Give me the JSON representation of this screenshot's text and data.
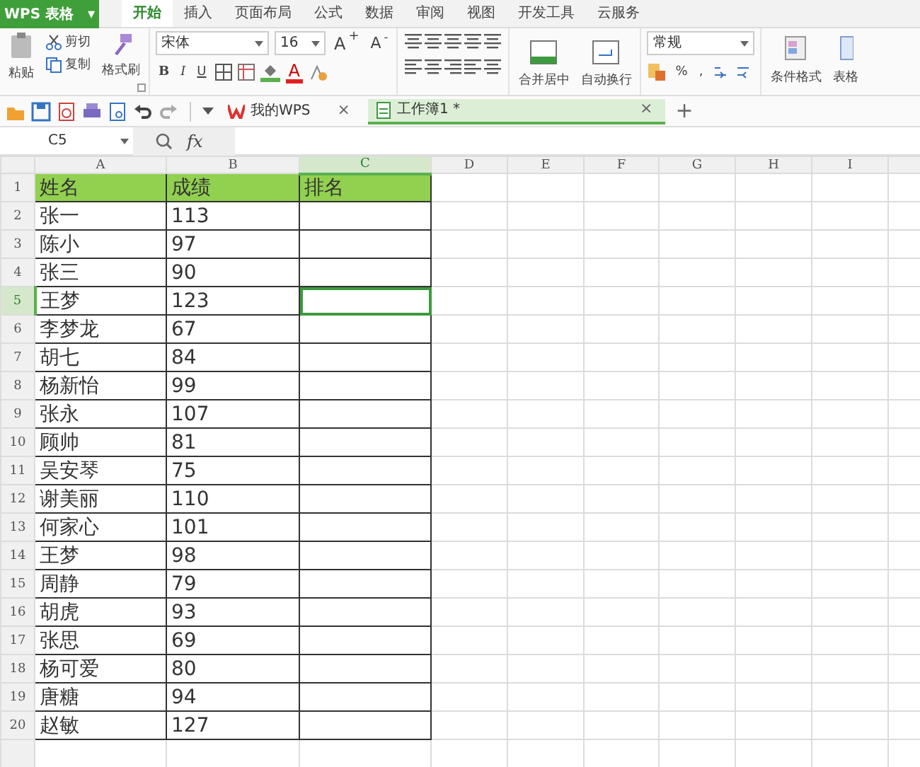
{
  "app": {
    "title": "WPS 表格",
    "menu_caret": "▾"
  },
  "ribbon_tabs": [
    {
      "label": "开始",
      "selected": true
    },
    {
      "label": "插入",
      "selected": false
    },
    {
      "label": "页面布局",
      "selected": false
    },
    {
      "label": "公式",
      "selected": false
    },
    {
      "label": "数据",
      "selected": false
    },
    {
      "label": "审阅",
      "selected": false
    },
    {
      "label": "视图",
      "selected": false
    },
    {
      "label": "开发工具",
      "selected": false
    },
    {
      "label": "云服务",
      "selected": false
    }
  ],
  "clipboard": {
    "paste": "粘贴",
    "cut": "剪切",
    "copy": "复制",
    "format_painter": "格式刷"
  },
  "font": {
    "name": "宋体",
    "size": "16",
    "grow": "A$^{+}$",
    "shrink": "A$^{-}$",
    "bold": "B",
    "italic": "I",
    "underline": "U",
    "font_color": "A"
  },
  "alignment": {
    "merge": "合并居中",
    "wrap": "自动换行"
  },
  "number": {
    "format": "常规",
    "percent": "%",
    "comma": ","
  },
  "styles": {
    "conditional": "条件格式",
    "table": "表格"
  },
  "doc_tabs": [
    {
      "label": "我的WPS",
      "selected": false,
      "close": "×"
    },
    {
      "label": "工作簿1 *",
      "selected": true,
      "close": "×"
    }
  ],
  "new_tab": "+",
  "formula_bar": {
    "name_box": "C5",
    "fx": "fx"
  },
  "sheet": {
    "columns": [
      {
        "label": "A",
        "selected": false
      },
      {
        "label": "B",
        "selected": false
      },
      {
        "label": "C",
        "selected": true
      },
      {
        "label": "D",
        "selected": false
      },
      {
        "label": "E",
        "selected": false
      },
      {
        "label": "F",
        "selected": false
      },
      {
        "label": "G",
        "selected": false
      },
      {
        "label": "H",
        "selected": false
      },
      {
        "label": "I",
        "selected": false
      }
    ],
    "rows": [
      {
        "number": "1",
        "selected": false,
        "kind": "header",
        "cells": [
          "姓名",
          "成绩",
          "排名"
        ]
      },
      {
        "number": "2",
        "selected": false,
        "kind": "data",
        "cells": [
          "张一",
          "113"
        ]
      },
      {
        "number": "3",
        "selected": false,
        "kind": "data",
        "cells": [
          "陈小",
          "97"
        ]
      },
      {
        "number": "4",
        "selected": false,
        "kind": "data",
        "cells": [
          "张三",
          "90"
        ]
      },
      {
        "number": "5",
        "selected": true,
        "kind": "data",
        "cells": [
          "王梦",
          "123"
        ]
      },
      {
        "number": "6",
        "selected": false,
        "kind": "data",
        "cells": [
          "李梦龙",
          "67"
        ]
      },
      {
        "number": "7",
        "selected": false,
        "kind": "data",
        "cells": [
          "胡七",
          "84"
        ]
      },
      {
        "number": "8",
        "selected": false,
        "kind": "data",
        "cells": [
          "杨新怡",
          "99"
        ]
      },
      {
        "number": "9",
        "selected": false,
        "kind": "data",
        "cells": [
          "张永",
          "107"
        ]
      },
      {
        "number": "10",
        "selected": false,
        "kind": "data",
        "cells": [
          "顾帅",
          "81"
        ]
      },
      {
        "number": "11",
        "selected": false,
        "kind": "data",
        "cells": [
          "吴安琴",
          "75"
        ]
      },
      {
        "number": "12",
        "selected": false,
        "kind": "data",
        "cells": [
          "谢美丽",
          "110"
        ]
      },
      {
        "number": "13",
        "selected": false,
        "kind": "data",
        "cells": [
          "何家心",
          "101"
        ]
      },
      {
        "number": "14",
        "selected": false,
        "kind": "data",
        "cells": [
          "王梦",
          "98"
        ]
      },
      {
        "number": "15",
        "selected": false,
        "kind": "data",
        "cells": [
          "周静",
          "79"
        ]
      },
      {
        "number": "16",
        "selected": false,
        "kind": "data",
        "cells": [
          "胡虎",
          "93"
        ]
      },
      {
        "number": "17",
        "selected": false,
        "kind": "data",
        "cells": [
          "张思",
          "69"
        ]
      },
      {
        "number": "18",
        "selected": false,
        "kind": "data",
        "cells": [
          "杨可爱",
          "80"
        ]
      },
      {
        "number": "19",
        "selected": false,
        "kind": "data",
        "cells": [
          "唐糖",
          "94"
        ]
      },
      {
        "number": "20",
        "selected": false,
        "kind": "data",
        "cells": [
          "赵敏",
          "127"
        ]
      }
    ]
  }
}
